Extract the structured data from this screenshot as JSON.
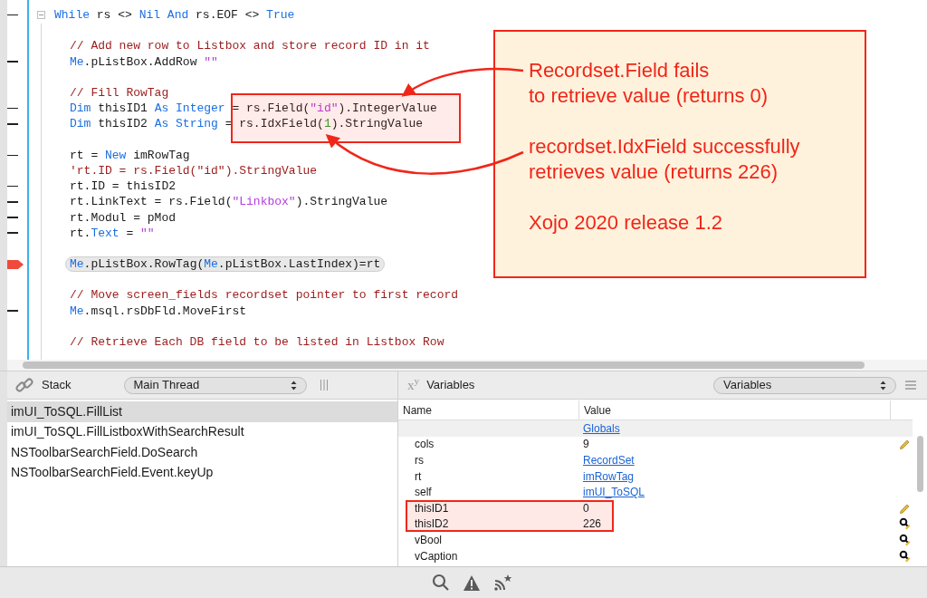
{
  "code": {
    "lines": [
      {
        "kind": "code",
        "step_marker": true,
        "breakpoint": false,
        "foldable": true,
        "current": false,
        "tokens": [
          {
            "kind": "keyword",
            "text": "While"
          },
          {
            "kind": "plain",
            "text": " rs <> "
          },
          {
            "kind": "keyword",
            "text": "Nil"
          },
          {
            "kind": "keyword",
            "text": " And"
          },
          {
            "kind": "plain",
            "text": " rs.EOF <> "
          },
          {
            "kind": "keyword",
            "text": "True"
          }
        ],
        "children": [
          {
            "kind": "blank",
            "step_marker": false,
            "breakpoint": false,
            "current": false
          },
          {
            "kind": "code",
            "step_marker": false,
            "breakpoint": false,
            "current": false,
            "tokens": [
              {
                "kind": "comment",
                "text": "// Add new row to Listbox and store record ID in it"
              }
            ]
          },
          {
            "kind": "code",
            "step_marker": true,
            "breakpoint": false,
            "current": false,
            "tokens": [
              {
                "kind": "keyword",
                "text": "Me"
              },
              {
                "kind": "plain",
                "text": ".pListBox.AddRow "
              },
              {
                "kind": "string",
                "text": "\"\""
              }
            ]
          },
          {
            "kind": "blank",
            "step_marker": false,
            "breakpoint": false,
            "current": false
          },
          {
            "kind": "code",
            "step_marker": false,
            "breakpoint": false,
            "current": false,
            "tokens": [
              {
                "kind": "comment",
                "text": "// Fill RowTag"
              }
            ]
          },
          {
            "kind": "code",
            "step_marker": true,
            "breakpoint": false,
            "current": false,
            "tokens": [
              {
                "kind": "keyword",
                "text": "Dim"
              },
              {
                "kind": "plain",
                "text": " thisID1 "
              },
              {
                "kind": "keyword",
                "text": "As"
              },
              {
                "kind": "keyword",
                "text": " Integer"
              },
              {
                "kind": "plain",
                "text": " = rs.Field("
              },
              {
                "kind": "string",
                "text": "\"id\""
              },
              {
                "kind": "plain",
                "text": ").IntegerValue"
              }
            ]
          },
          {
            "kind": "code",
            "step_marker": true,
            "breakpoint": false,
            "current": false,
            "tokens": [
              {
                "kind": "keyword",
                "text": "Dim"
              },
              {
                "kind": "plain",
                "text": " thisID2 "
              },
              {
                "kind": "keyword",
                "text": "As"
              },
              {
                "kind": "keyword",
                "text": " String"
              },
              {
                "kind": "plain",
                "text": " = rs.IdxField("
              },
              {
                "kind": "number",
                "text": "1"
              },
              {
                "kind": "plain",
                "text": ").StringValue"
              }
            ]
          },
          {
            "kind": "blank",
            "step_marker": false,
            "breakpoint": false,
            "current": false
          },
          {
            "kind": "code",
            "step_marker": true,
            "breakpoint": false,
            "current": false,
            "tokens": [
              {
                "kind": "plain",
                "text": "rt = "
              },
              {
                "kind": "keyword",
                "text": "New"
              },
              {
                "kind": "plain",
                "text": " imRowTag"
              }
            ]
          },
          {
            "kind": "code",
            "step_marker": false,
            "breakpoint": false,
            "current": false,
            "tokens": [
              {
                "kind": "comment",
                "text": "'rt.ID = rs.Field(\"id\").StringValue"
              }
            ]
          },
          {
            "kind": "code",
            "step_marker": true,
            "breakpoint": false,
            "current": false,
            "tokens": [
              {
                "kind": "plain",
                "text": "rt.ID = thisID2"
              }
            ]
          },
          {
            "kind": "code",
            "step_marker": true,
            "breakpoint": false,
            "current": false,
            "tokens": [
              {
                "kind": "plain",
                "text": "rt.LinkText = rs.Field("
              },
              {
                "kind": "string",
                "text": "\"Linkbox\""
              },
              {
                "kind": "plain",
                "text": ").StringValue"
              }
            ]
          },
          {
            "kind": "code",
            "step_marker": true,
            "breakpoint": false,
            "current": false,
            "tokens": [
              {
                "kind": "plain",
                "text": "rt.Modul = pMod"
              }
            ]
          },
          {
            "kind": "code",
            "step_marker": true,
            "breakpoint": false,
            "current": false,
            "tokens": [
              {
                "kind": "plain",
                "text": "rt."
              },
              {
                "kind": "keyword",
                "text": "Text"
              },
              {
                "kind": "plain",
                "text": " = "
              },
              {
                "kind": "string",
                "text": "\"\""
              }
            ]
          },
          {
            "kind": "blank",
            "step_marker": false,
            "breakpoint": false,
            "current": false
          },
          {
            "kind": "code",
            "step_marker": false,
            "breakpoint": true,
            "current": true,
            "tokens": [
              {
                "kind": "keyword",
                "text": "Me"
              },
              {
                "kind": "plain",
                "text": ".pListBox.RowTag("
              },
              {
                "kind": "keyword",
                "text": "Me"
              },
              {
                "kind": "plain",
                "text": ".pListBox.LastIndex)=rt"
              }
            ]
          },
          {
            "kind": "blank",
            "step_marker": false,
            "breakpoint": false,
            "current": false
          },
          {
            "kind": "code",
            "step_marker": false,
            "breakpoint": false,
            "current": false,
            "tokens": [
              {
                "kind": "comment",
                "text": "// Move screen_fields recordset pointer to first record"
              }
            ]
          },
          {
            "kind": "code",
            "step_marker": true,
            "breakpoint": false,
            "current": false,
            "tokens": [
              {
                "kind": "keyword",
                "text": "Me"
              },
              {
                "kind": "plain",
                "text": ".msql.rsDbFld.MoveFirst"
              }
            ]
          },
          {
            "kind": "blank",
            "step_marker": false,
            "breakpoint": false,
            "current": false
          },
          {
            "kind": "code",
            "step_marker": false,
            "breakpoint": false,
            "current": false,
            "tokens": [
              {
                "kind": "comment",
                "text": "// Retrieve Each DB field to be listed in Listbox Row"
              }
            ]
          }
        ]
      }
    ]
  },
  "callout": {
    "paragraphs": [
      {
        "lines": [
          "Recordset.Field fails",
          "to retrieve value (returns 0)"
        ]
      },
      {
        "lines": [
          "recordset.IdxField successfully",
          "retrieves value (returns 226)"
        ]
      },
      {
        "lines": [
          "Xojo 2020 release 1.2"
        ]
      }
    ]
  },
  "stack": {
    "title": "Stack",
    "thread": "Main Thread",
    "frames": [
      {
        "label": "imUI_ToSQL.FillList",
        "selected": true
      },
      {
        "label": "imUI_ToSQL.FillListboxWithSearchResult",
        "selected": false
      },
      {
        "label": "NSToolbarSearchField.DoSearch",
        "selected": false
      },
      {
        "label": "NSToolbarSearchField.Event.keyUp",
        "selected": false
      }
    ]
  },
  "variables": {
    "symbol": "x$^{y}$",
    "title": "Variables",
    "view": "Variables",
    "columns": [
      "Name",
      "Value"
    ],
    "rows": [
      {
        "kind": "group",
        "value": "Globals"
      },
      {
        "kind": "variable",
        "name": "cols",
        "value": "9",
        "link": false,
        "editable": true,
        "inspectable": false,
        "highlighted": false
      },
      {
        "kind": "variable",
        "name": "rs",
        "value": "RecordSet",
        "link": true,
        "editable": false,
        "inspectable": false,
        "highlighted": false
      },
      {
        "kind": "variable",
        "name": "rt",
        "value": "imRowTag",
        "link": true,
        "editable": false,
        "inspectable": false,
        "highlighted": false
      },
      {
        "kind": "variable",
        "name": "self",
        "value": "imUI_ToSQL",
        "link": true,
        "editable": false,
        "inspectable": false,
        "highlighted": false
      },
      {
        "kind": "variable",
        "name": "thisID1",
        "value": "0",
        "link": false,
        "editable": true,
        "inspectable": false,
        "highlighted": true
      },
      {
        "kind": "variable",
        "name": "thisID2",
        "value": "226",
        "link": false,
        "editable": true,
        "inspectable": true,
        "highlighted": true
      },
      {
        "kind": "variable",
        "name": "vBool",
        "editable": true,
        "inspectable": true,
        "highlighted": false
      },
      {
        "kind": "variable",
        "name": "vCaption",
        "editable": true,
        "inspectable": true,
        "highlighted": false
      }
    ]
  }
}
